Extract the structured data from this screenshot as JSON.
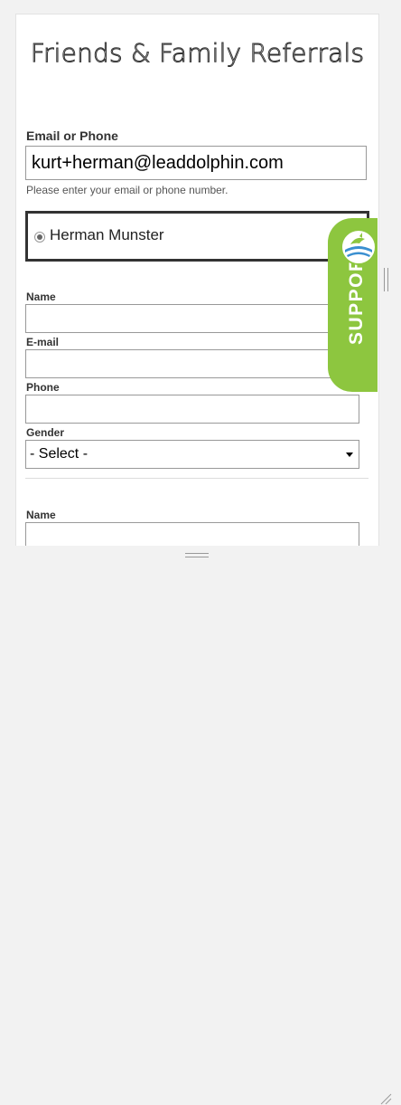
{
  "form": {
    "title": "Friends & Family Referrals",
    "email_label": "Email or Phone",
    "email_value": "kurt+herman@leaddolphin.com",
    "email_help": "Please enter your email or phone number.",
    "selected_contact": "Herman Munster"
  },
  "referral_1": {
    "name_label": "Name",
    "email_label": "E-mail",
    "phone_label": "Phone",
    "gender_label": "Gender",
    "gender_selected": "- Select -"
  },
  "referral_2": {
    "name_label": "Name"
  },
  "support_widget": {
    "label": "SUPPORT",
    "color": "#8dc63f"
  }
}
